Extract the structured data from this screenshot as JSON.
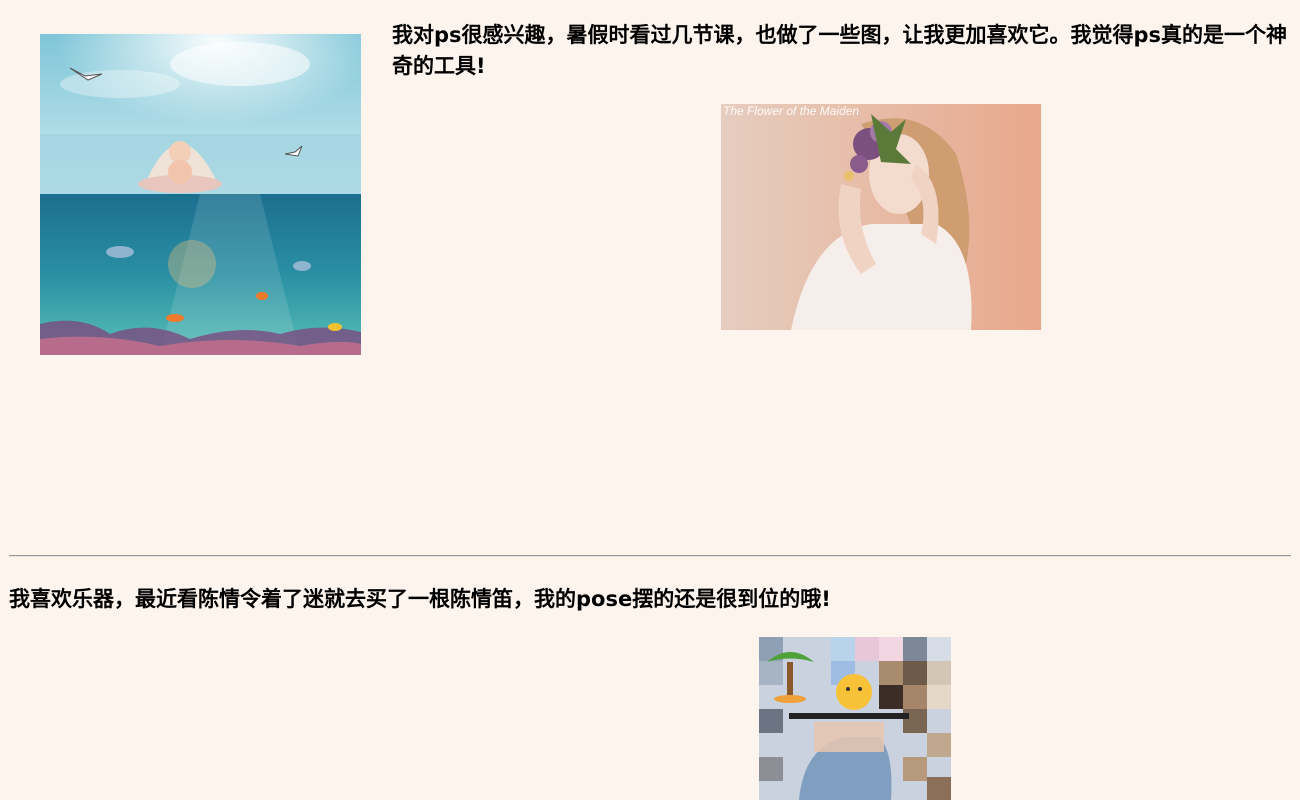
{
  "section1": {
    "intro_text": "我对ps很感兴趣，暑假时看过几节课，也做了一些图，让我更加喜欢它。我觉得ps真的是一个神奇的工具!",
    "maiden_caption": "The Flower of the Maiden"
  },
  "section2": {
    "music_text": "我喜欢乐器，最近看陈情令着了迷就去买了一根陈情笛，我的pose摆的还是很到位的哦!"
  },
  "colors": {
    "page_background": "#fef4ee",
    "divider": "#9a9a9a"
  }
}
